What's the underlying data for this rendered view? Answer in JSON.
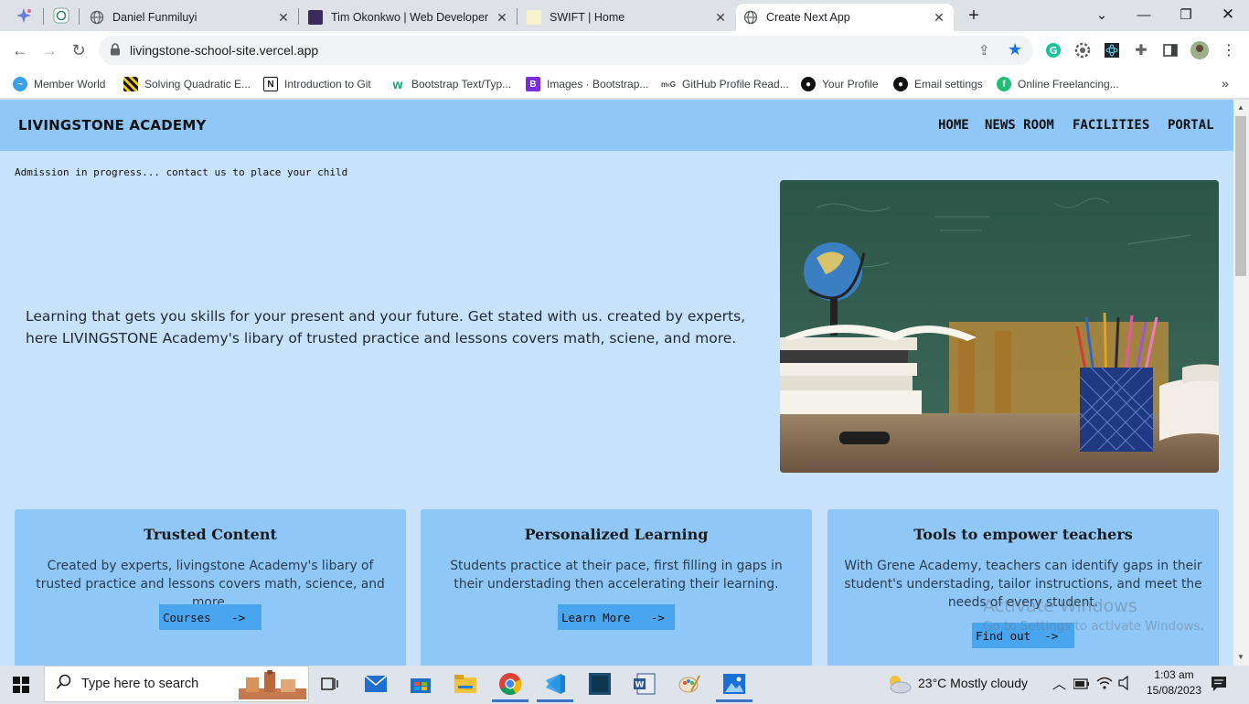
{
  "browser": {
    "tabs": [
      {
        "title": "Daniel Funmiluyi",
        "icon": "globe-icon"
      },
      {
        "title": "Tim Okonkwo | Web Developer",
        "icon": "avatar-icon"
      },
      {
        "title": "SWIFT | Home",
        "icon": "swift-icon"
      },
      {
        "title": "Create Next App",
        "icon": "globe-icon",
        "active": true
      }
    ],
    "url": "livingstone-school-site.vercel.app",
    "bookmarks": [
      {
        "label": "Member World",
        "icon": "member-world-icon"
      },
      {
        "label": "Solving Quadratic E...",
        "icon": "hazard-stripe-icon"
      },
      {
        "label": "Introduction to Git",
        "icon": "notion-icon"
      },
      {
        "label": "Bootstrap Text/Typ...",
        "icon": "w3-icon"
      },
      {
        "label": "Images · Bootstrap...",
        "icon": "bootstrap-icon"
      },
      {
        "label": "GitHub Profile Read...",
        "icon": "mdg-icon"
      },
      {
        "label": "Your Profile",
        "icon": "github-icon"
      },
      {
        "label": "Email settings",
        "icon": "github-icon"
      },
      {
        "label": "Online Freelancing...",
        "icon": "fiverr-icon"
      }
    ]
  },
  "site": {
    "brand": "LIVINGSTONE ACADEMY",
    "nav": [
      "HOME",
      "NEWS ROOM",
      "FACILITIES",
      "PORTAL"
    ],
    "admission": "Admission in progress... contact us to place your child",
    "hero_text": "Learning that gets you skills for your present and your future. Get stated with us. created by experts, here LIVINGSTONE Academy's libary of trusted practice and lessons covers math, sciene, and more.",
    "cards": [
      {
        "title": "Trusted Content",
        "text": "Created by experts, livingstone Academy's libary of trusted practice and lessons covers math, science, and more.",
        "button": "Courses   ->"
      },
      {
        "title": "Personalized Learning",
        "text": "Students practice at their pace, first filling in gaps in their understading then accelerating their learning.",
        "button": "Learn More   ->"
      },
      {
        "title": "Tools to empower teachers",
        "text": "With Grene Academy, teachers can identify gaps in their student's understading, tailor instructions, and meet the needs of every student.",
        "button": "Find out  ->"
      }
    ]
  },
  "watermark": {
    "line1": "Activate Windows",
    "line2": "Go to Settings to activate Windows."
  },
  "taskbar": {
    "search_placeholder": "Type here to search",
    "weather": "23°C  Mostly cloudy",
    "time": "1:03 am",
    "date": "15/08/2023"
  }
}
